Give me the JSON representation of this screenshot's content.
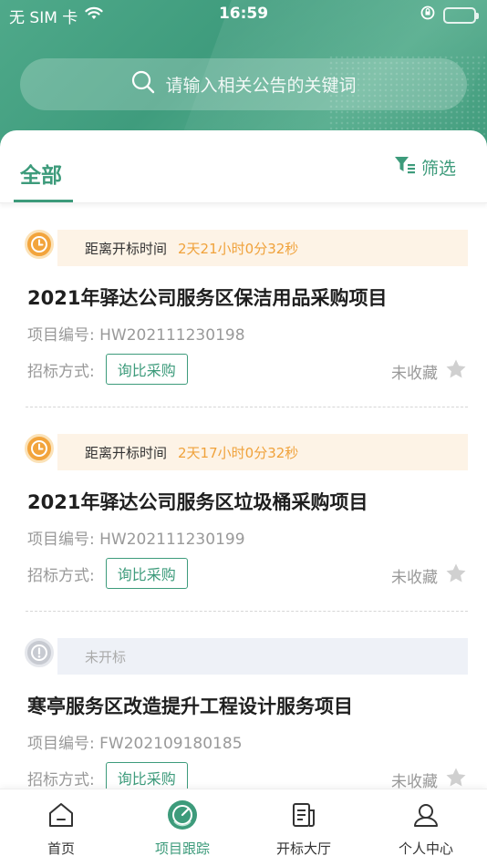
{
  "status_bar": {
    "carrier": "无 SIM 卡",
    "time": "16:59"
  },
  "search": {
    "placeholder": "请输入相关公告的关键词"
  },
  "tabs": {
    "all_label": "全部",
    "filter_label": "筛选"
  },
  "items": [
    {
      "countdown_label": "距离开标时间",
      "countdown_value": "2天21小时0分32秒",
      "title": "2021年驿达公司服务区保洁用品采购项目",
      "code": "项目编号: HW202111230198",
      "method_label": "招标方式:",
      "method": "询比采购",
      "fav_label": "未收藏"
    },
    {
      "countdown_label": "距离开标时间",
      "countdown_value": "2天17小时0分32秒",
      "title": "2021年驿达公司服务区垃圾桶采购项目",
      "code": "项目编号: HW202111230199",
      "method_label": "招标方式:",
      "method": "询比采购",
      "fav_label": "未收藏"
    },
    {
      "countdown_label": "未开标",
      "countdown_value": "",
      "title": "寒亭服务区改造提升工程设计服务项目",
      "code": "项目编号: FW202109180185",
      "method_label": "招标方式:",
      "method": "询比采购",
      "fav_label": "未收藏"
    }
  ],
  "tabbar": [
    {
      "label": "首页",
      "icon": "home-icon"
    },
    {
      "label": "项目跟踪",
      "icon": "tracking-icon"
    },
    {
      "label": "开标大厅",
      "icon": "hall-icon"
    },
    {
      "label": "个人中心",
      "icon": "user-icon"
    }
  ],
  "colors": {
    "accent": "#3d9b7b",
    "countdown_orange": "#f0a23b"
  }
}
